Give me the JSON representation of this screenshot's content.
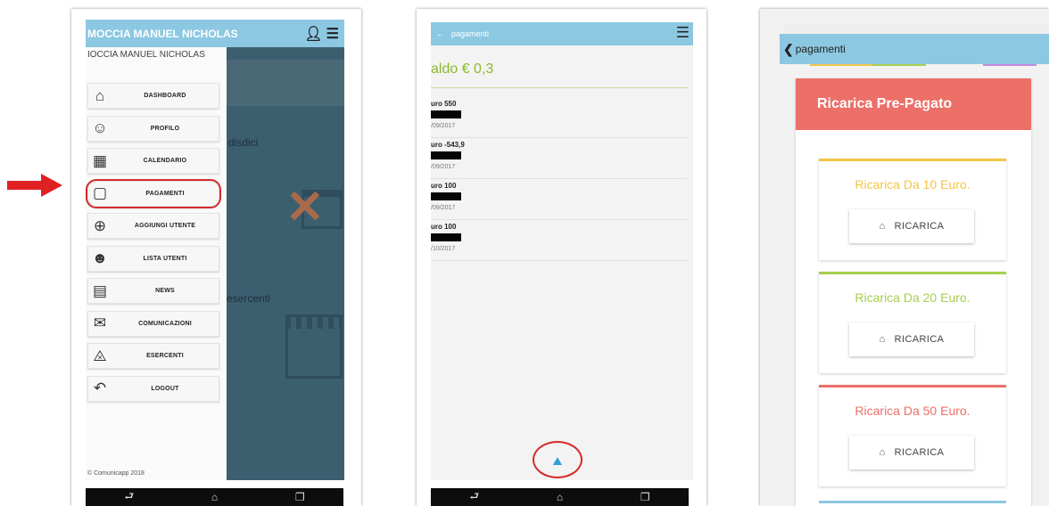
{
  "colors": {
    "appbar": "#8cc8e2",
    "annotation": "#e02121",
    "saldo": "#8dbb2c",
    "header_red": "#ec6f68",
    "card_orange": "#f2c548",
    "card_green": "#a5cf4d",
    "card_red": "#ec6f68",
    "card_blue": "#8cc8e2"
  },
  "screen1": {
    "user_name": "MOCCIA MANUEL NICHOLAS",
    "drawer_name": "IOCCIA MANUEL NICHOLAS",
    "header_icons": [
      "user-icon",
      "hamburger-icon"
    ],
    "menu": [
      {
        "icon": "home-icon",
        "label": "DASHBOARD"
      },
      {
        "icon": "user-icon",
        "label": "PROFILO"
      },
      {
        "icon": "calendar-icon",
        "label": "CALENDARIO"
      },
      {
        "icon": "wallet-icon",
        "label": "PAGAMENTI",
        "selected": true
      },
      {
        "icon": "add-user-icon",
        "label": "AGGIUNGI UTENTE"
      },
      {
        "icon": "users-icon",
        "label": "LISTA UTENTI"
      },
      {
        "icon": "newspaper-icon",
        "label": "NEWS"
      },
      {
        "icon": "mail-icon",
        "label": "COMUNICAZIONI"
      },
      {
        "icon": "cart-icon",
        "label": "ESERCENTI"
      },
      {
        "icon": "logout-icon",
        "label": "LOGOUT"
      }
    ],
    "background_text_1": "disdici",
    "background_text_2": "esercenti",
    "footer": "© Comunicapp 2018"
  },
  "screen2": {
    "title": "pagamenti",
    "back_icon": "back-arrow-icon",
    "saldo": "aldo € 0,3",
    "payments": [
      {
        "amount": "uro 550",
        "date": "/09/2017"
      },
      {
        "amount": "uro -543,9",
        "date": "/09/2017"
      },
      {
        "amount": "uro 100",
        "date": "/09/2017"
      },
      {
        "amount": "uro 100",
        "date": "/10/2017"
      }
    ],
    "fab_icon": "recharge-icon"
  },
  "screen3": {
    "title": "pagamenti",
    "header": "Ricarica Pre-Pagato",
    "options": [
      {
        "title": "Ricarica Da 10 Euro.",
        "button": "RICARICA",
        "color": "#f2c548"
      },
      {
        "title": "Ricarica Da 20 Euro.",
        "button": "RICARICA",
        "color": "#a5cf4d"
      },
      {
        "title": "Ricarica Da 50 Euro.",
        "button": "RICARICA",
        "color": "#ec6f68"
      }
    ]
  }
}
